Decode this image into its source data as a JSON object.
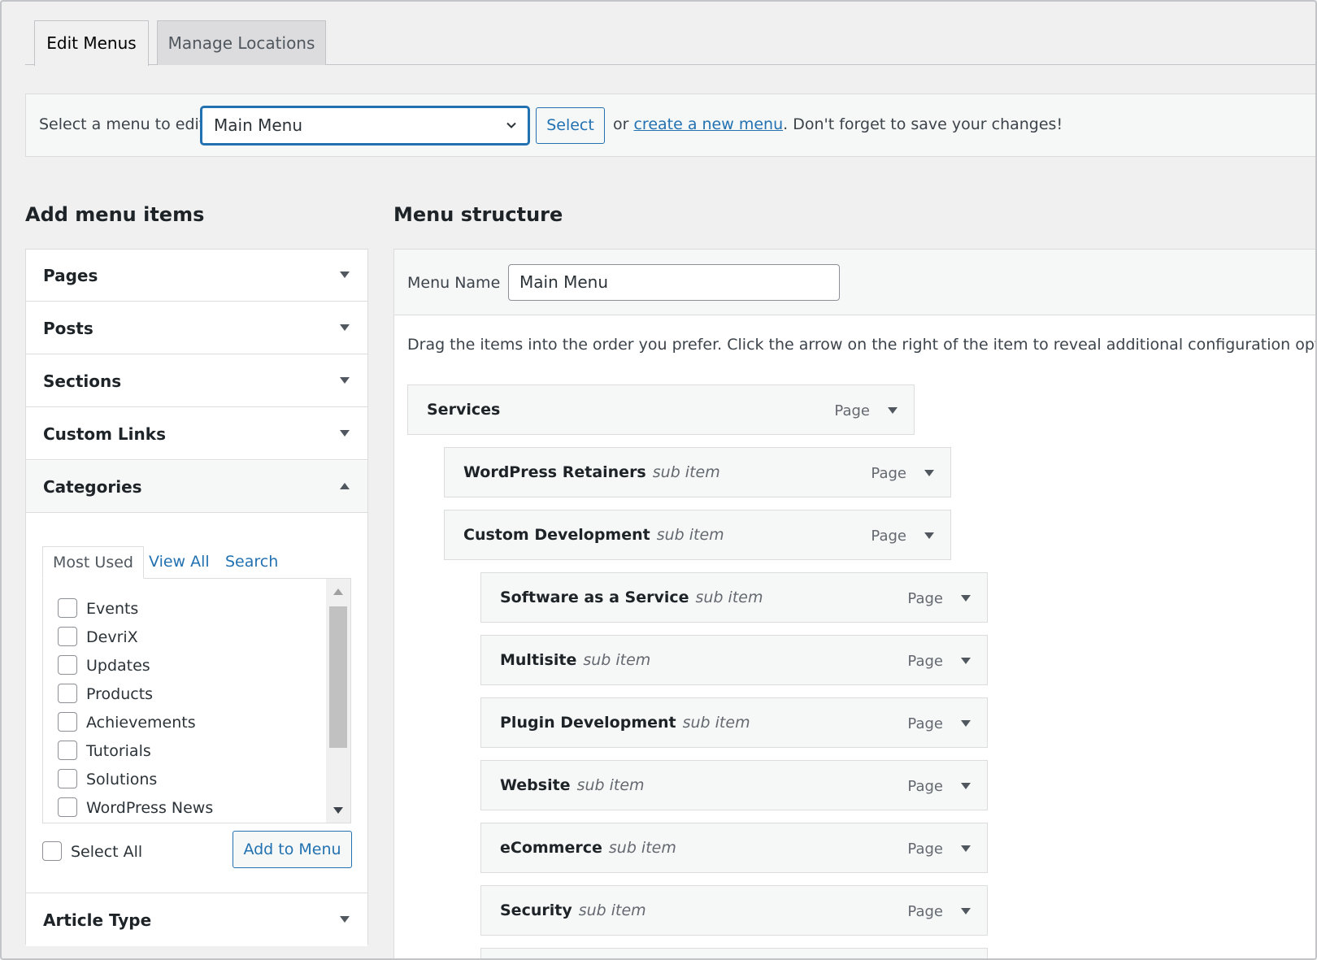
{
  "tabs": [
    {
      "label": "Edit Menus",
      "active": true
    },
    {
      "label": "Manage Locations",
      "active": false
    }
  ],
  "manage": {
    "label": "Select a menu to edit:",
    "selected": "Main Menu",
    "select_button": "Select",
    "text_before": "or",
    "create_link": "create a new menu",
    "text_after": ". Don't forget to save your changes!"
  },
  "headings": {
    "add": "Add menu items",
    "structure": "Menu structure"
  },
  "accordion": {
    "sections": [
      {
        "title": "Pages",
        "open": false
      },
      {
        "title": "Posts",
        "open": false
      },
      {
        "title": "Sections",
        "open": false
      },
      {
        "title": "Custom Links",
        "open": false
      },
      {
        "title": "Categories",
        "open": true
      },
      {
        "title": "Article Type",
        "open": false
      }
    ],
    "categories": {
      "tabs": [
        "Most Used",
        "View All",
        "Search"
      ],
      "items": [
        "Events",
        "DevriX",
        "Updates",
        "Products",
        "Achievements",
        "Tutorials",
        "Solutions",
        "WordPress News"
      ],
      "select_all": "Select All",
      "add_button": "Add to Menu"
    }
  },
  "structure": {
    "name_label": "Menu Name",
    "name_value": "Main Menu",
    "instructions": "Drag the items into the order you prefer. Click the arrow on the right of the item to reveal additional configuration options.",
    "items": [
      {
        "title": "Services",
        "sub": "",
        "type": "Page",
        "depth": 0
      },
      {
        "title": "WordPress Retainers",
        "sub": "sub item",
        "type": "Page",
        "depth": 1
      },
      {
        "title": "Custom Development",
        "sub": "sub item",
        "type": "Page",
        "depth": 1
      },
      {
        "title": "Software as a Service",
        "sub": "sub item",
        "type": "Page",
        "depth": 2
      },
      {
        "title": "Multisite",
        "sub": "sub item",
        "type": "Page",
        "depth": 2
      },
      {
        "title": "Plugin Development",
        "sub": "sub item",
        "type": "Page",
        "depth": 2
      },
      {
        "title": "Website",
        "sub": "sub item",
        "type": "Page",
        "depth": 2
      },
      {
        "title": "eCommerce",
        "sub": "sub item",
        "type": "Page",
        "depth": 2
      },
      {
        "title": "Security",
        "sub": "sub item",
        "type": "Page",
        "depth": 2
      }
    ]
  },
  "colors": {
    "accent": "#2271b1",
    "background": "#f0f0f1",
    "panel": "#f6f7f7",
    "border": "#dcdcde"
  }
}
